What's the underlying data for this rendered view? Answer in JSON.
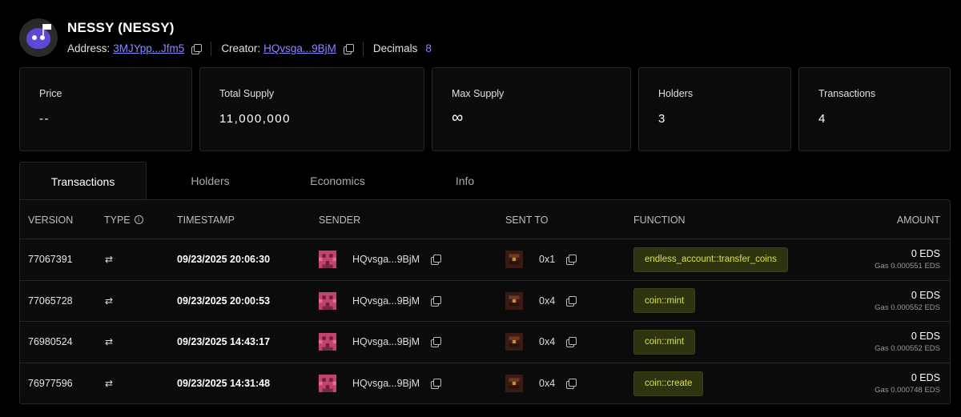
{
  "token": {
    "title": "NESSY (NESSY)",
    "address_label": "Address:",
    "address": "3MJYpp...Jfm5",
    "creator_label": "Creator:",
    "creator": "HQvsga...9BjM",
    "decimals_label": "Decimals",
    "decimals": "8"
  },
  "stats": [
    {
      "label": "Price",
      "value": "--"
    },
    {
      "label": "Total Supply",
      "value": "11,000,000"
    },
    {
      "label": "Max Supply",
      "value": "∞"
    },
    {
      "label": "Holders",
      "value": "3"
    },
    {
      "label": "Transactions",
      "value": "4"
    }
  ],
  "tabs": [
    {
      "label": "Transactions",
      "active": true
    },
    {
      "label": "Holders",
      "active": false
    },
    {
      "label": "Economics",
      "active": false
    },
    {
      "label": "Info",
      "active": false
    }
  ],
  "table": {
    "columns": {
      "version": "VERSION",
      "type": "TYPE",
      "timestamp": "TIMESTAMP",
      "sender": "SENDER",
      "sent_to": "SENT TO",
      "function": "FUNCTION",
      "amount": "AMOUNT"
    },
    "rows": [
      {
        "version": "77067391",
        "type": "↩",
        "timestamp": "09/23/2025 20:06:30",
        "sender": "HQvsga...9BjM",
        "sent_to": "0x1",
        "function": "endless_account::transfer_coins",
        "amount": "0 EDS",
        "gas": "Gas 0.000551 EDS"
      },
      {
        "version": "77065728",
        "type": "↩",
        "timestamp": "09/23/2025 20:00:53",
        "sender": "HQvsga...9BjM",
        "sent_to": "0x4",
        "function": "coin::mint",
        "amount": "0 EDS",
        "gas": "Gas 0.000552 EDS"
      },
      {
        "version": "76980524",
        "type": "↩",
        "timestamp": "09/23/2025 14:43:17",
        "sender": "HQvsga...9BjM",
        "sent_to": "0x4",
        "function": "coin::mint",
        "amount": "0 EDS",
        "gas": "Gas 0.000552 EDS"
      },
      {
        "version": "76977596",
        "type": "↩",
        "timestamp": "09/23/2025 14:31:48",
        "sender": "HQvsga...9BjM",
        "sent_to": "0x4",
        "function": "coin::create",
        "amount": "0 EDS",
        "gas": "Gas 0.000748 EDS"
      }
    ]
  },
  "colors": {
    "accent": "#8b86ff",
    "function_bg": "#2f3410",
    "function_text": "#d7e04a",
    "sender_avatar": "#c2436b",
    "recipient_avatar": "#3a1a12"
  }
}
